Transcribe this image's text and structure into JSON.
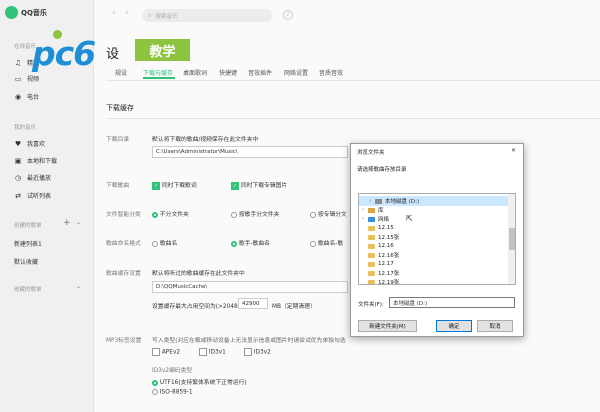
{
  "app": {
    "title": "QQ音乐"
  },
  "sidebar": {
    "online_section": "在线音乐",
    "online_items": [
      "精选",
      "视频",
      "电台"
    ],
    "my_section": "我的音乐",
    "my_items": [
      {
        "label": "我喜欢",
        "icon": "heart-icon"
      },
      {
        "label": "本地和下载",
        "icon": "computer-icon"
      },
      {
        "label": "最近播放",
        "icon": "clock-icon"
      },
      {
        "label": "试听列表",
        "icon": "shuffle-icon"
      }
    ],
    "created_section": "创建的歌单",
    "created_items": [
      "新建列表1",
      "默认收藏"
    ],
    "collected_section": "收藏的歌单"
  },
  "topbar": {
    "back": "‹",
    "forward": "›",
    "search_placeholder": "搜索音乐",
    "mic": "♪"
  },
  "watermark": {
    "logo_text": "pc6",
    "badge": "教学"
  },
  "main": {
    "title_fragment": "设",
    "tabs": [
      "常规设置",
      "下载与缓存",
      "桌面歌词",
      "快捷键",
      "音效插件",
      "网络设置",
      "音质音效"
    ],
    "active_tab": 1,
    "tab_first_visible": "规设"
  },
  "download": {
    "section_title": "下载缓存",
    "dir_label": "下载目录",
    "dir_desc": "默认将下载的歌曲/视频保存在此文件夹中",
    "dir_value": "C:\\Users\\Administrator\\Music\\",
    "songs_label": "下载歌曲",
    "songs_lyrics": "同时下载歌词",
    "songs_cover": "同时下载专辑图片",
    "smart_label": "文件智能分类",
    "smart_opts": [
      "不分文件夹",
      "按歌手分文件夹",
      "按专辑分文"
    ],
    "naming_label": "歌曲命名格式",
    "naming_opts": [
      "歌曲名",
      "歌手-歌曲名",
      "歌曲名-歌"
    ],
    "cache_label": "歌曲缓存设置",
    "cache_desc": "默认将听过的歌曲缓存在此文件夹中",
    "cache_value": "D:\\QQMusicCache\\",
    "cache_max_prefix": "设置缓存最大占用空间为(>2048)",
    "cache_max_value": "42900",
    "cache_max_suffix": "MB（定期清理）",
    "mp3_label": "MP3标签设置",
    "mp3_desc": "写入类型(对应在载或移动设备上无法显示信息或图片时请尝试优先单独勾选",
    "mp3_opts": [
      "APEv2",
      "ID3v1",
      "ID3v2"
    ],
    "id3_label": "ID3v2编码类型",
    "id3_opts": [
      "UTF16(支持繁体系统下正常运行)",
      "ISO-8859-1"
    ]
  },
  "dialog": {
    "title": "浏览文件夹",
    "close": "✕",
    "prompt": "请选择歌曲存放目录",
    "tree": [
      {
        "label": "本地磁盘 (D:)",
        "kind": "drive",
        "indent": 1,
        "selected": true
      },
      {
        "label": "库",
        "kind": "lib",
        "indent": 0
      },
      {
        "label": "网络",
        "kind": "net",
        "indent": 0
      },
      {
        "label": "12.15",
        "kind": "folder",
        "indent": 0
      },
      {
        "label": "12.15张",
        "kind": "folder",
        "indent": 0
      },
      {
        "label": "12.16",
        "kind": "folder",
        "indent": 0
      },
      {
        "label": "12.16张",
        "kind": "folder",
        "indent": 0
      },
      {
        "label": "12.17",
        "kind": "folder",
        "indent": 0
      },
      {
        "label": "12.17张",
        "kind": "folder",
        "indent": 0
      },
      {
        "label": "12.19张",
        "kind": "folder",
        "indent": 0
      },
      {
        "label": "12.20",
        "kind": "folder",
        "indent": 0
      }
    ],
    "folder_label": "文件夹(F):",
    "folder_value": "本地磁盘 (D:)",
    "new_folder": "新建文件夹(M)",
    "ok": "确定",
    "cancel": "取消"
  },
  "colors": {
    "accent": "#31c27c",
    "sidebar_bg": "#f0f0f0",
    "folder": "#e8c15a",
    "selection": "#cce8ff"
  }
}
